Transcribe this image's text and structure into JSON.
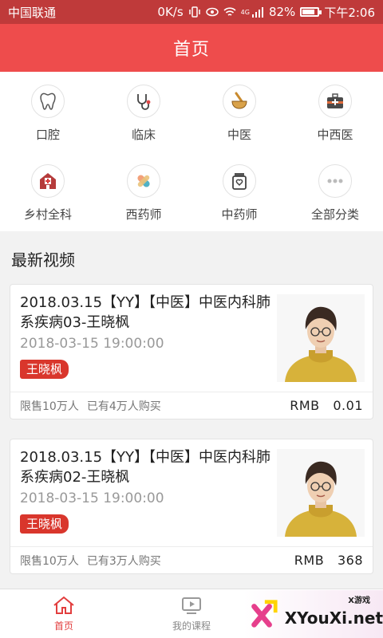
{
  "status_bar": {
    "carrier": "中国联通",
    "net_speed": "0K/s",
    "network_type": "4G",
    "battery": "82%",
    "battery_level": 0.82,
    "time": "下午2:06"
  },
  "header": {
    "title": "首页"
  },
  "categories": [
    {
      "label": "口腔",
      "icon": "tooth-icon"
    },
    {
      "label": "临床",
      "icon": "stethoscope-icon"
    },
    {
      "label": "中医",
      "icon": "mortar-pestle-icon"
    },
    {
      "label": "中西医",
      "icon": "medical-kit-icon"
    },
    {
      "label": "乡村全科",
      "icon": "hospital-icon"
    },
    {
      "label": "西药师",
      "icon": "pill-icon"
    },
    {
      "label": "中药师",
      "icon": "medicine-jar-icon"
    },
    {
      "label": "全部分类",
      "icon": "more-icon"
    }
  ],
  "section": {
    "title": "最新视频"
  },
  "videos": [
    {
      "title": "2018.03.15【YY】【中医】中医内科肺系疾病03-王晓枫",
      "time": "2018-03-15 19:00:00",
      "teacher": "王晓枫",
      "limit": "限售10万人",
      "sold": "已有4万人购买",
      "price": "RMB   0.01"
    },
    {
      "title": "2018.03.15【YY】【中医】中医内科肺系疾病02-王晓枫",
      "time": "2018-03-15 19:00:00",
      "teacher": "王晓枫",
      "limit": "限售10万人",
      "sold": "已有3万人购买",
      "price": "RMB   368"
    }
  ],
  "tabbar": {
    "items": [
      {
        "label": "首页",
        "icon": "home-icon",
        "active": true
      },
      {
        "label": "我的课程",
        "icon": "video-course-icon",
        "active": false
      }
    ]
  },
  "watermark": {
    "text": "XYouXi.net",
    "small": "X游戏"
  },
  "colors": {
    "primary": "#ee4c4c",
    "statusbar": "#bf3a3a",
    "tag": "#d9362c"
  }
}
